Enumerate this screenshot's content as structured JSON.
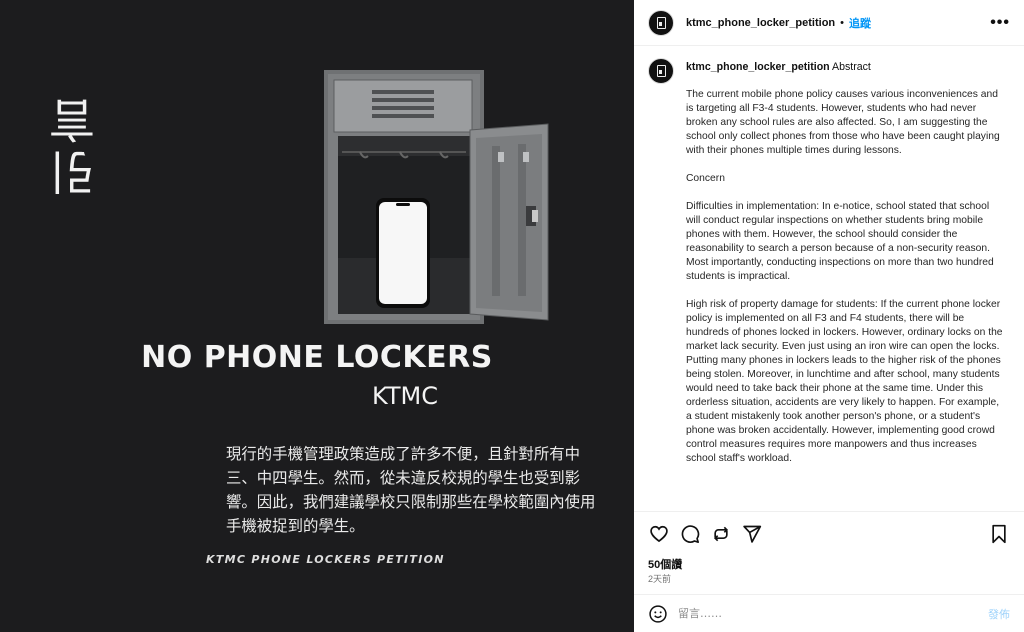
{
  "image": {
    "vertical_title": "引言",
    "headline": "NO PHONE LOCKERS",
    "school": "KTMC",
    "chinese_body": "現行的手機管理政策造成了許多不便，且針對所有中三、中四學生。然而，從未違反校規的學生也受到影響。因此，我們建議學校只限制那些在學校範圍內使用手機被捉到的學生。",
    "footer_caption": "KTMC PHONE LOCKERS PETITION",
    "background_color": "#1c1c1e"
  },
  "header": {
    "username": "ktmc_phone_locker_petition",
    "separator": "•",
    "follow_label": "追蹤",
    "more_icon": "more-horizontal-icon"
  },
  "caption": {
    "username": "ktmc_phone_locker_petition",
    "first_word": "Abstract",
    "paragraphs": [
      "The current mobile phone policy causes various inconveniences and is targeting all F3-4 students. However, students who had never broken any school rules are also affected. So, I am suggesting the school only collect phones from those who have been caught playing with their phones multiple times during lessons.",
      "Concern",
      "Difficulties in implementation: In e-notice, school stated that school will conduct regular inspections on whether students bring mobile phones with them. However, the school should consider the reasonability to search a person because of a non-security reason. Most importantly, conducting inspections on more than two hundred students is impractical.",
      "High risk of property damage for students: If the current phone locker policy is implemented on all F3 and F4 students, there will be hundreds of phones locked in lockers. However, ordinary locks on the market lack security. Even just using an iron wire can open the locks. Putting many phones in lockers leads to the higher risk of the phones being stolen. Moreover, in lunchtime and after school, many students would need to take back their phone at the same time. Under this orderless situation, accidents are very likely to happen. For example, a student mistakenly took another person's phone, or a student's phone was broken accidentally. However, implementing good crowd control measures requires more manpowers and thus increases school staff's workload."
    ]
  },
  "actions": {
    "icons": [
      "heart-icon",
      "comment-icon",
      "share-icon",
      "send-icon",
      "bookmark-icon"
    ]
  },
  "likes": "50個讚",
  "time_ago": "2天前",
  "comment": {
    "placeholder": "留言……",
    "post_label": "發佈",
    "accent_color": "#0095f6"
  }
}
